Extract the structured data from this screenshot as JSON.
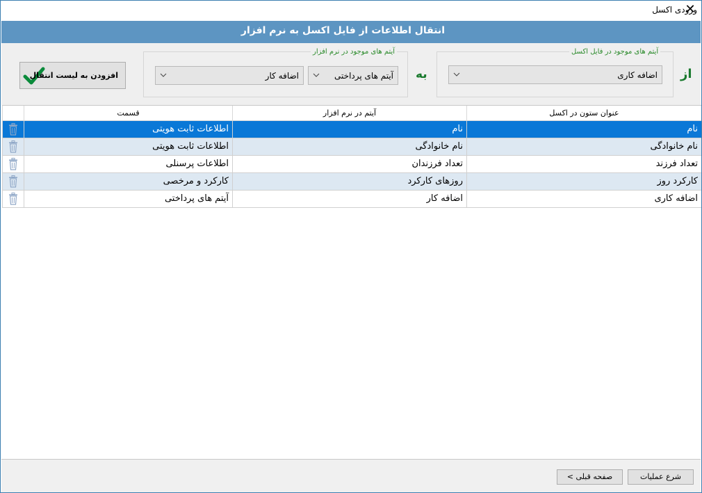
{
  "window": {
    "title": "ورودی اکسل",
    "close_glyph": "✕"
  },
  "header": {
    "title": "انتقال اطلاعات از فایل اکسل به نرم افزار"
  },
  "mapping": {
    "from_label": "از",
    "to_label": "به",
    "excel_group_legend": "آیتم های موجود در فایل اکسل",
    "excel_selected": "اضافه کاری",
    "software_group_legend": "آیتم های موجود در نرم افزار",
    "software_section_selected": "آیتم های پرداختی",
    "software_item_selected": "اضافه کار",
    "add_button_label": "افزودن به لیست انتقال"
  },
  "grid": {
    "columns": {
      "excel": "عنوان ستون در اکسل",
      "software": "آیتم در نرم افزار",
      "section": "قسمت"
    },
    "rows": [
      {
        "excel": "نام",
        "software": "نام",
        "section": "اطلاعات ثابت هویتی",
        "state": "selected"
      },
      {
        "excel": "نام خانوادگی",
        "software": "نام خانوادگی",
        "section": "اطلاعات ثابت هویتی",
        "state": "alt"
      },
      {
        "excel": "تعداد فرزند",
        "software": "تعداد فرزندان",
        "section": "اطلاعات پرسنلی",
        "state": "normal"
      },
      {
        "excel": "کارکرد روز",
        "software": "روزهای کارکرد",
        "section": "کارکرد و مرخصی",
        "state": "alt"
      },
      {
        "excel": "اضافه کاری",
        "software": "اضافه کار",
        "section": "آیتم های پرداختی",
        "state": "normal"
      }
    ]
  },
  "footer": {
    "start_label": "شرع عملیات",
    "prev_label": "صفحه قبلی  >"
  },
  "colors": {
    "header": "#5d95c2",
    "selected_row": "#0a78d7",
    "alt_row": "#dde8f2",
    "label_green": "#1a7a2e",
    "check_green": "#0a8a3a"
  },
  "icons": {
    "delete": "trash-icon",
    "add": "check-icon",
    "dropdown": "chevron-down-icon"
  }
}
